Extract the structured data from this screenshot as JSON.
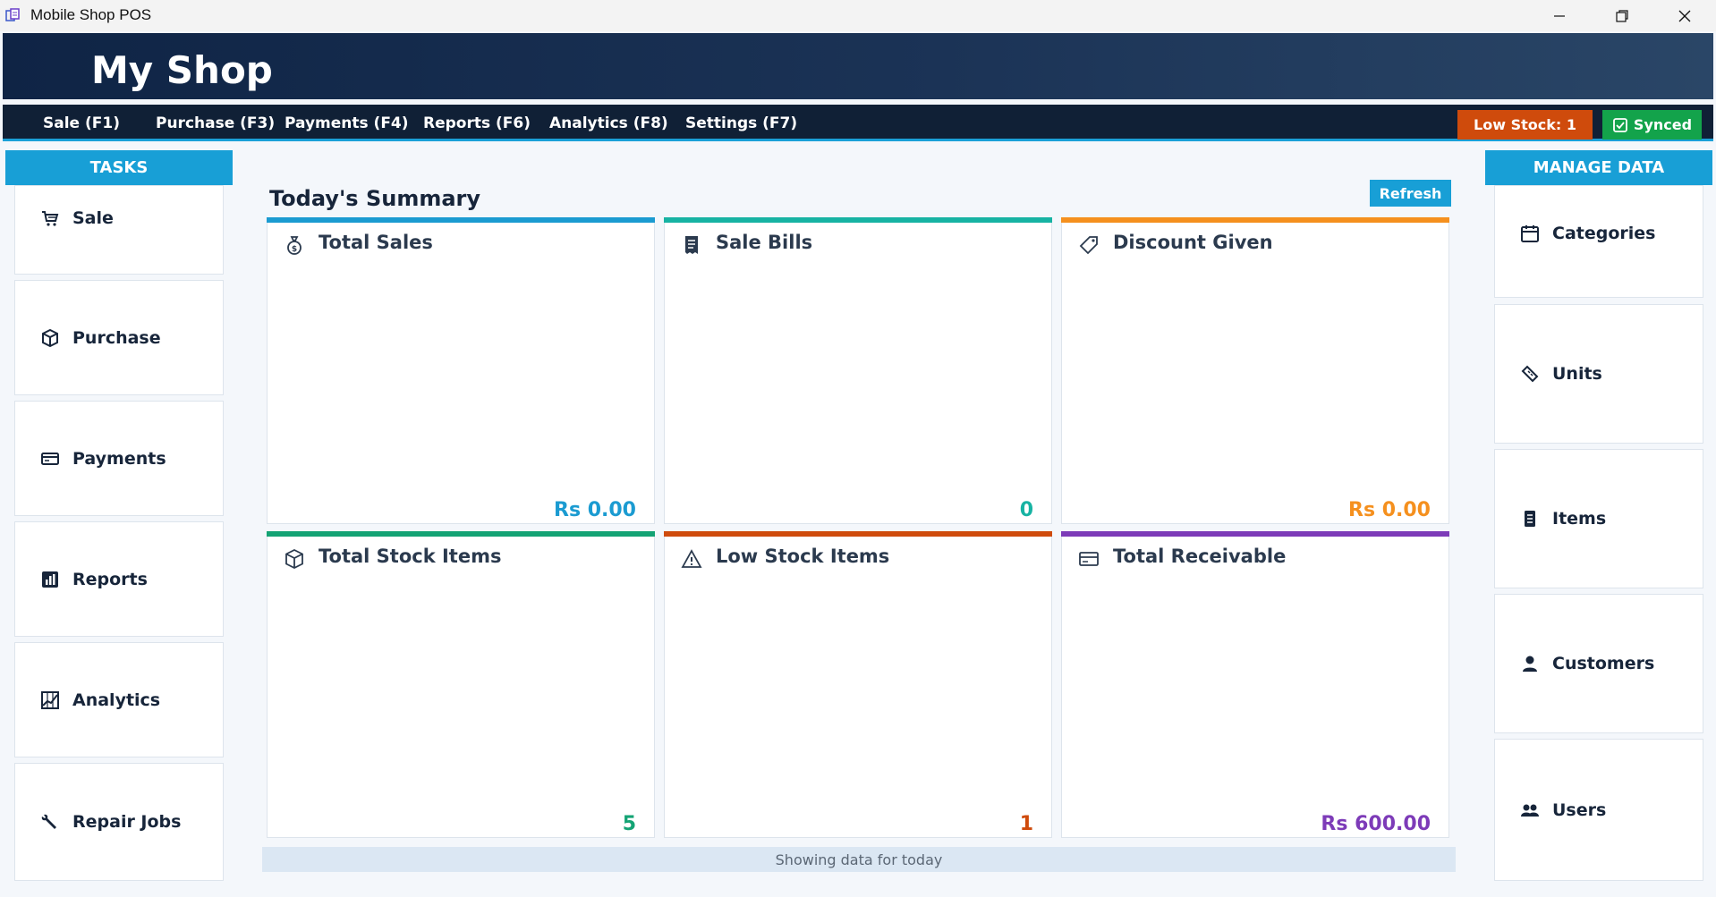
{
  "window": {
    "title": "Mobile Shop POS"
  },
  "header": {
    "shop_name": "My Shop"
  },
  "nav": {
    "items": [
      "Sale (F1)",
      "Purchase (F3)",
      "Payments (F4)",
      "Reports (F6)",
      "Analytics (F8)",
      "Settings (F7)"
    ],
    "low_stock_label": "Low Stock: 1",
    "synced_label": "Synced"
  },
  "tasks": {
    "title": "TASKS",
    "items": [
      {
        "label": "Sale",
        "icon": "cart-icon"
      },
      {
        "label": "Purchase",
        "icon": "box-icon"
      },
      {
        "label": "Payments",
        "icon": "card-icon"
      },
      {
        "label": "Reports",
        "icon": "report-icon"
      },
      {
        "label": "Analytics",
        "icon": "chart-icon"
      },
      {
        "label": "Repair Jobs",
        "icon": "wrench-icon"
      }
    ]
  },
  "summary": {
    "title": "Today's Summary",
    "refresh_label": "Refresh",
    "cards": [
      {
        "title": "Total Sales",
        "value": "Rs 0.00",
        "color": "#1b9bd1",
        "icon": "money-bag-icon"
      },
      {
        "title": "Sale Bills",
        "value": "0",
        "color": "#17b3a3",
        "icon": "receipt-icon"
      },
      {
        "title": "Discount Given",
        "value": "Rs 0.00",
        "color": "#f5901e",
        "icon": "tag-icon"
      },
      {
        "title": "Total Stock Items",
        "value": "5",
        "color": "#14a374",
        "icon": "box-icon"
      },
      {
        "title": "Low Stock Items",
        "value": "1",
        "color": "#cf4b0c",
        "icon": "warning-icon"
      },
      {
        "title": "Total Receivable",
        "value": "Rs 600.00",
        "color": "#7d3bb8",
        "icon": "card-icon"
      }
    ],
    "status_text": "Showing data for today"
  },
  "manage": {
    "title": "MANAGE DATA",
    "items": [
      {
        "label": "Categories",
        "icon": "calendar-icon"
      },
      {
        "label": "Units",
        "icon": "ruler-icon"
      },
      {
        "label": "Items",
        "icon": "list-icon"
      },
      {
        "label": "Customers",
        "icon": "user-icon"
      },
      {
        "label": "Users",
        "icon": "users-icon"
      }
    ]
  },
  "colors": {
    "accent": "#189fd6",
    "low_stock": "#cf4b0c",
    "synced": "#13a34b",
    "header_dark": "#102036"
  }
}
